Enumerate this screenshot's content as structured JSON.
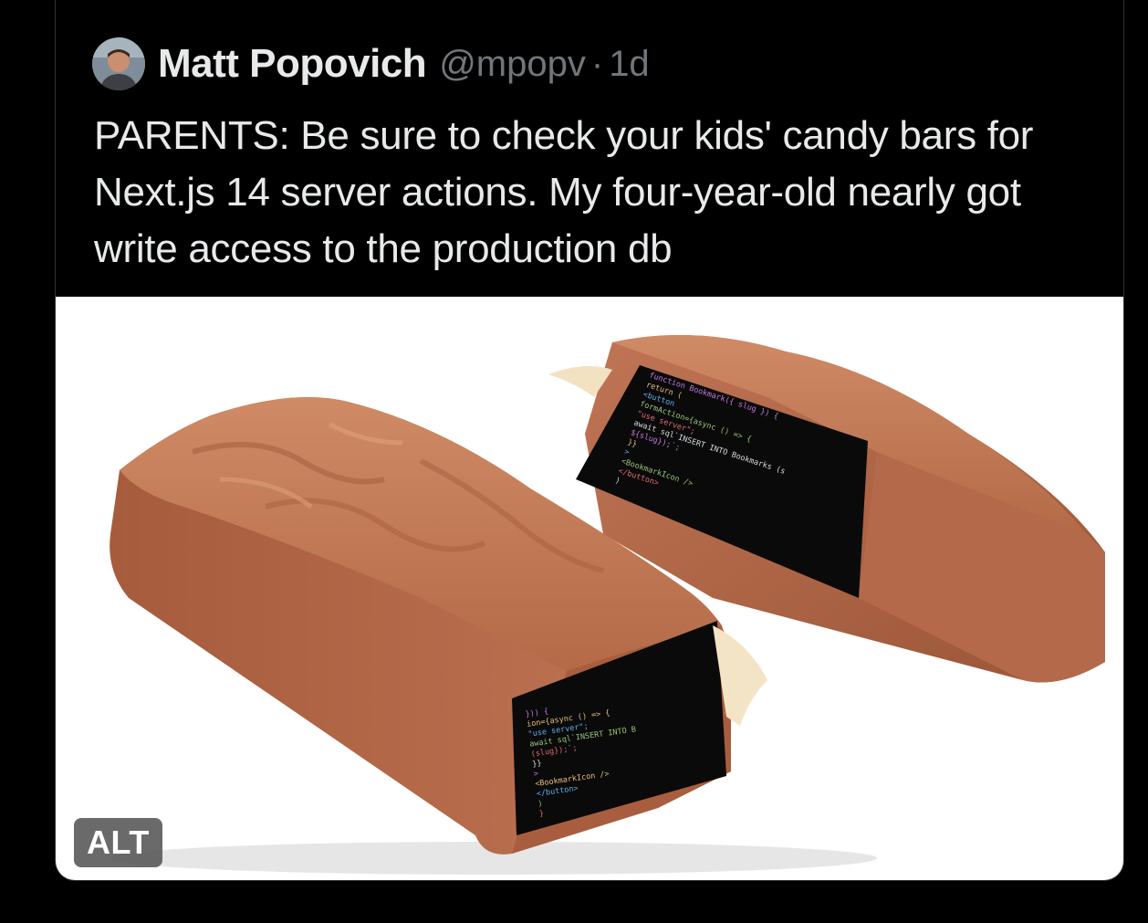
{
  "tweet": {
    "author_name": "Matt Popovich",
    "handle": "@mpopv",
    "separator": "·",
    "time": "1d",
    "text": "PARENTS: Be sure to check your kids' candy bars for Next.js 14 server actions. My four-year-old nearly got write access to the production db"
  },
  "media": {
    "alt_badge": "ALT",
    "code_lines_right": [
      "function Bookmark({ slug }) {",
      "  return (",
      "    <button",
      "      formAction={async () => {",
      "        \"use server\";",
      "        await sql`INSERT INTO Bookmarks (s",
      "${slug});`;",
      "      }}",
      "    >",
      "      <BookmarkIcon />",
      "    </button>",
      "  )"
    ],
    "code_lines_left": [
      "  })) {",
      "  ion={async () => {",
      "  \"use server\";",
      "  await sql`INSERT INTO B",
      "(slug});`;",
      "  }}",
      "  >",
      "    <BookmarkIcon />",
      "    </button>",
      "  )",
      "}"
    ]
  },
  "colors": {
    "background": "#000000",
    "text": "#e7e9ea",
    "muted": "#71767b",
    "chocolate": "#b86f4c",
    "chocolate_dark": "#8f4f33",
    "chocolate_light": "#cf8a66"
  }
}
